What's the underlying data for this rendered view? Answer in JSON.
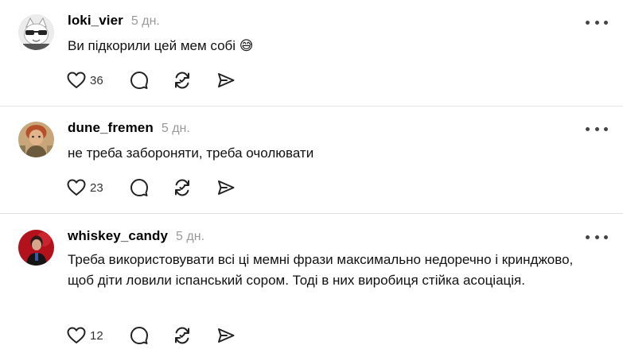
{
  "posts": [
    {
      "username": "loki_vier",
      "time": "5 дн.",
      "text": "Ви підкорили цей мем собі 😅",
      "likes": "36",
      "avatar_icon": "cat-sunglasses-avatar"
    },
    {
      "username": "dune_fremen",
      "time": "5 дн.",
      "text": "не треба забороняти, треба очолювати",
      "likes": "23",
      "avatar_icon": "person-avatar"
    },
    {
      "username": "whiskey_candy",
      "time": "5 дн.",
      "text": "Треба використовувати всі ці мемні фрази максимально недоречно і кринджово, щоб діти ловили іспанський сором. Тоді в них виробиця стійка асоціація.",
      "likes": "12",
      "avatar_icon": "person-red-avatar"
    }
  ],
  "colors": {
    "timestamp": "#999999",
    "divider": "#e4e4e4",
    "icon": "#222222"
  },
  "icons": [
    "heart-icon",
    "comment-icon",
    "repost-icon",
    "share-icon",
    "more-icon"
  ]
}
